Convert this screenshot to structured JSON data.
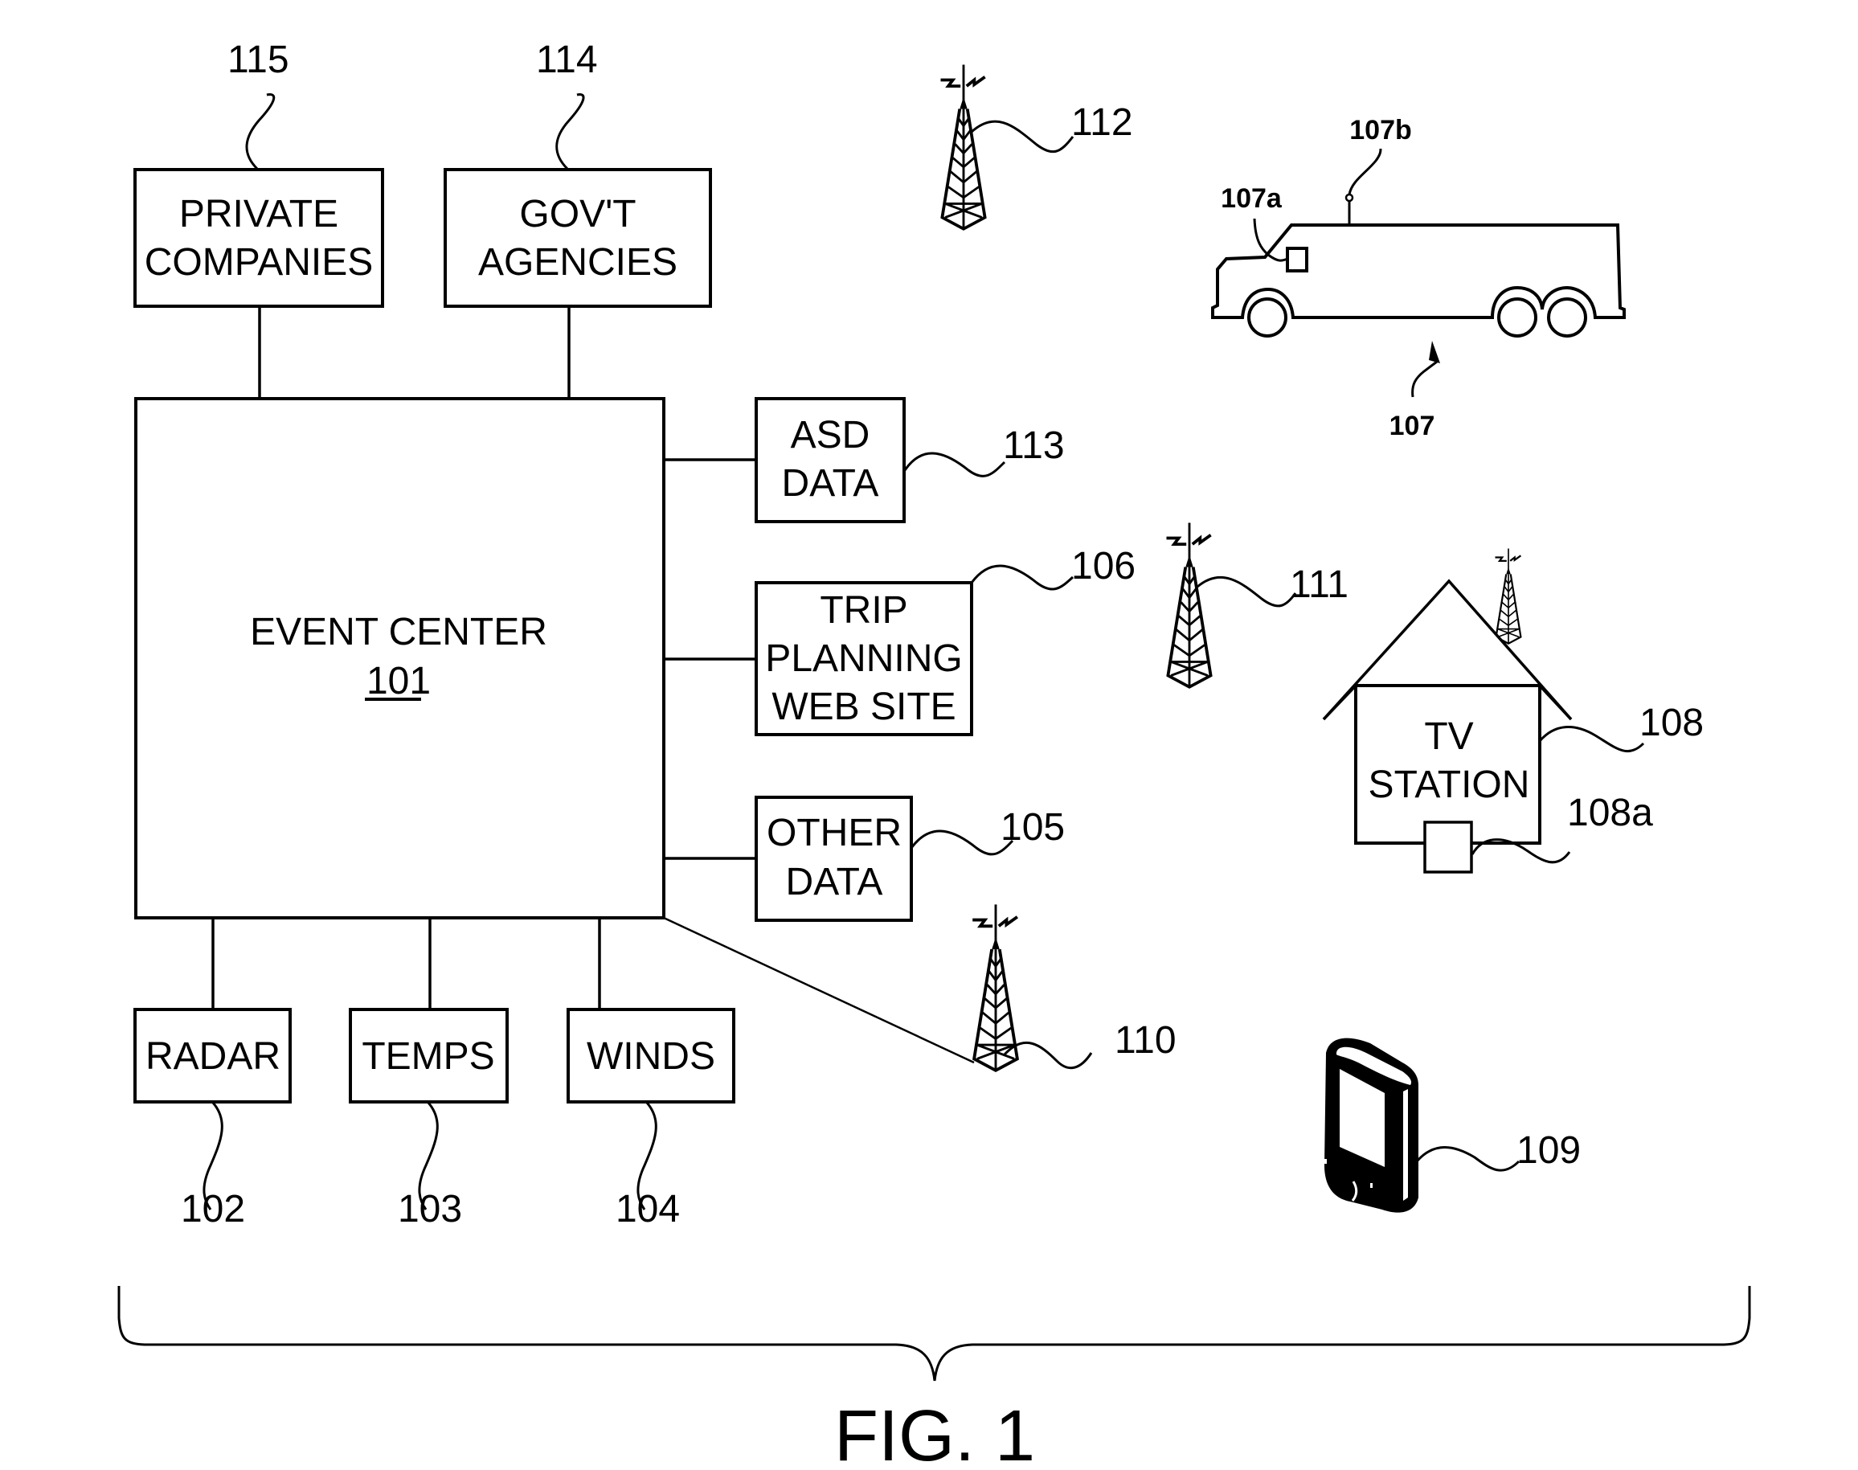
{
  "figure": {
    "caption": "FIG. 1",
    "colors": {
      "ink": "#000000",
      "background": "#ffffff"
    }
  },
  "blocks": {
    "private_companies": {
      "lines": [
        "PRIVATE",
        "COMPANIES"
      ],
      "ref": "115"
    },
    "govt_agencies": {
      "lines": [
        "GOV'T",
        "AGENCIES"
      ],
      "ref": "114"
    },
    "event_center": {
      "lines": [
        "EVENT CENTER"
      ],
      "ref": "101"
    },
    "asd_data": {
      "lines": [
        "ASD",
        "DATA"
      ],
      "ref": "113"
    },
    "trip_planning": {
      "lines": [
        "TRIP",
        "PLANNING",
        "WEB SITE"
      ],
      "ref": "106"
    },
    "other_data": {
      "lines": [
        "OTHER",
        "DATA"
      ],
      "ref": "105"
    },
    "radar": {
      "lines": [
        "RADAR"
      ],
      "ref": "102"
    },
    "temps": {
      "lines": [
        "TEMPS"
      ],
      "ref": "103"
    },
    "winds": {
      "lines": [
        "WINDS"
      ],
      "ref": "104"
    },
    "tv_station": {
      "lines": [
        "TV",
        "STATION"
      ],
      "ref": "108",
      "device_ref": "108a"
    }
  },
  "devices": {
    "tower_112": {
      "icon": "radio-tower-icon",
      "ref": "112"
    },
    "tower_111": {
      "icon": "radio-tower-icon",
      "ref": "111"
    },
    "tower_110": {
      "icon": "radio-tower-icon",
      "ref": "110"
    },
    "vehicle": {
      "icon": "truck-icon",
      "ref": "107",
      "display_ref": "107a",
      "antenna_ref": "107b"
    },
    "handheld": {
      "icon": "mobile-device-icon",
      "ref": "109"
    }
  }
}
